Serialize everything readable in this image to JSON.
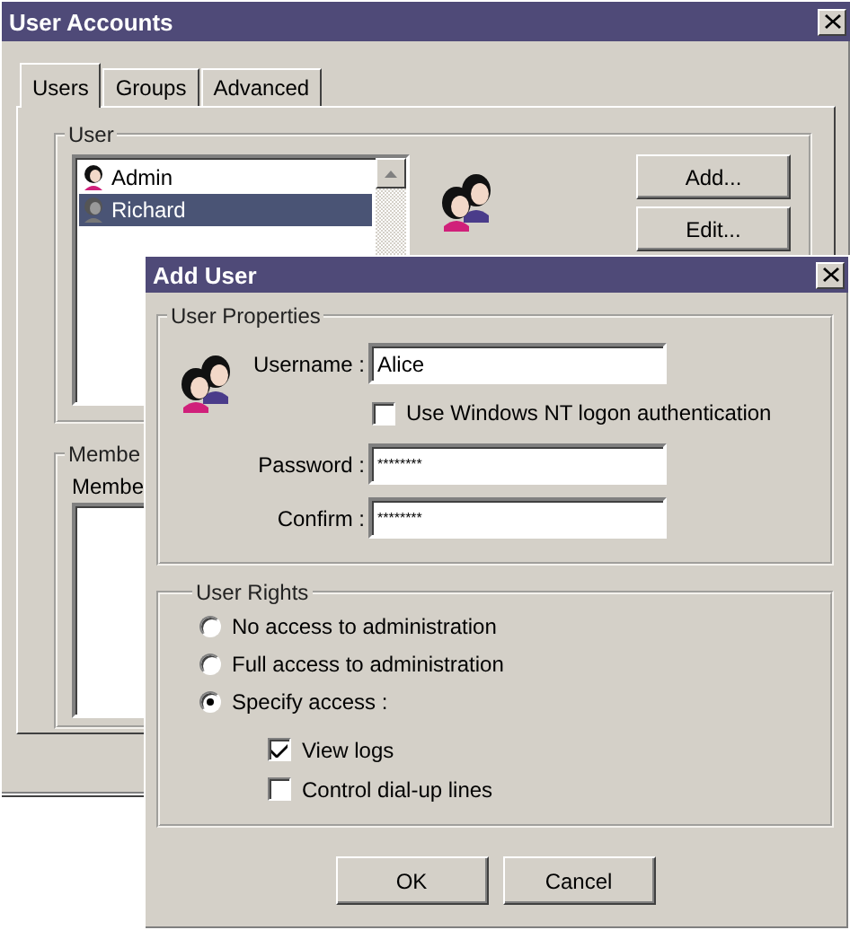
{
  "back_window": {
    "title": "User Accounts",
    "tabs": [
      {
        "label": "Users",
        "selected": true
      },
      {
        "label": "Groups",
        "selected": false
      },
      {
        "label": "Advanced",
        "selected": false
      }
    ],
    "user_group": {
      "label": "User",
      "users": [
        {
          "name": "Admin",
          "selected": false
        },
        {
          "name": "Richard",
          "selected": true
        }
      ],
      "buttons": [
        "Add...",
        "Edit..."
      ]
    },
    "member_group": {
      "label": "Membe",
      "list_label": "Membe"
    }
  },
  "dialog": {
    "title": "Add User",
    "properties_group": {
      "label": "User Properties",
      "rows": [
        {
          "kind": "field",
          "label": "Username :",
          "value": "Alice"
        },
        {
          "kind": "checkbox",
          "label": "Use Windows NT logon authentication",
          "checked": false
        },
        {
          "kind": "field",
          "label": "Password :",
          "value": "********"
        },
        {
          "kind": "field",
          "label": "Confirm :",
          "value": "********"
        }
      ]
    },
    "rights_group": {
      "label": "User Rights",
      "options": [
        {
          "label": "No access to administration",
          "selected": false
        },
        {
          "label": "Full access to administration",
          "selected": false
        },
        {
          "label": "Specify access :",
          "selected": true
        }
      ],
      "permissions": [
        {
          "label": "View logs",
          "checked": true
        },
        {
          "label": "Control dial-up lines",
          "checked": false
        }
      ]
    },
    "buttons": [
      "OK",
      "Cancel"
    ]
  }
}
